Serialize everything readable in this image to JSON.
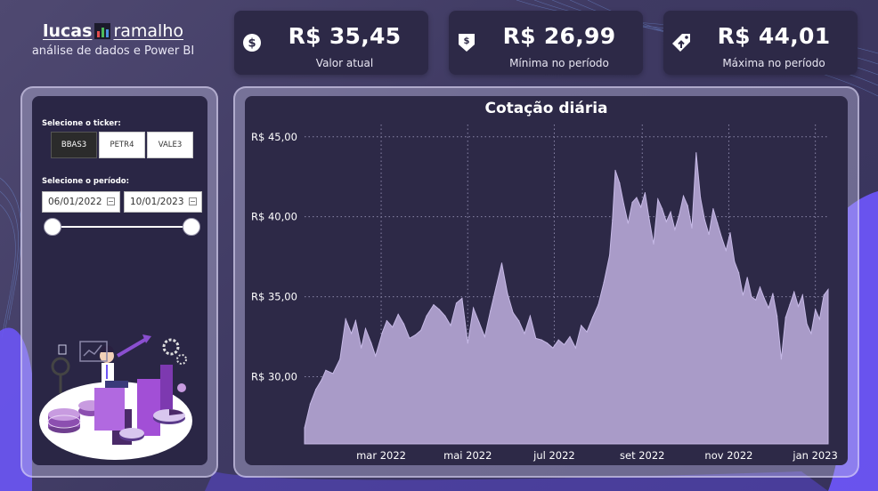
{
  "brand": {
    "name_part1": "lucas",
    "name_part2": "ramalho",
    "subtitle": "análise de dados e Power BI"
  },
  "kpis": [
    {
      "value": "R$ 35,45",
      "label": "Valor atual",
      "icon": "dollar-coin-icon"
    },
    {
      "value": "R$ 26,99",
      "label": "Mínima no período",
      "icon": "price-down-icon"
    },
    {
      "value": "R$ 44,01",
      "label": "Máxima no período",
      "icon": "price-tag-up-icon"
    }
  ],
  "filters": {
    "ticker_label": "Selecione o ticker:",
    "tickers": [
      "BBAS3",
      "PETR4",
      "VALE3"
    ],
    "selected_ticker": "BBAS3",
    "period_label": "Selecione o período:",
    "start_date": "06/01/2022",
    "end_date": "10/01/2023"
  },
  "colors": {
    "background": "#423d66",
    "card": "#2d2947",
    "area_fill": "#a99bc8",
    "accent": "#6c55f5"
  },
  "chart_data": {
    "type": "area",
    "title": "Cotação diária",
    "xlabel": "",
    "ylabel": "",
    "y_tick_labels": [
      "R$ 30,00",
      "R$ 35,00",
      "R$ 40,00",
      "R$ 45,00"
    ],
    "y_ticks": [
      30,
      35,
      40,
      45
    ],
    "ylim": [
      25.8,
      45.6
    ],
    "x_tick_labels": [
      "mar 2022",
      "mai 2022",
      "jul 2022",
      "set 2022",
      "nov 2022",
      "jan 2023"
    ],
    "x_ticks": [
      "2022-03-01",
      "2022-05-01",
      "2022-07-01",
      "2022-09-01",
      "2022-11-01",
      "2023-01-01"
    ],
    "xlim": [
      "2022-01-06",
      "2023-01-10"
    ],
    "grid": true,
    "series": [
      {
        "dates": [
          "2022-01-06",
          "2022-01-10",
          "2022-01-14",
          "2022-01-18",
          "2022-01-21",
          "2022-01-26",
          "2022-01-31",
          "2022-02-04",
          "2022-02-08",
          "2022-02-11",
          "2022-02-15",
          "2022-02-18",
          "2022-02-22",
          "2022-02-25",
          "2022-03-02",
          "2022-03-05",
          "2022-03-09",
          "2022-03-13",
          "2022-03-17",
          "2022-03-21",
          "2022-03-25",
          "2022-03-29",
          "2022-04-02",
          "2022-04-07",
          "2022-04-11",
          "2022-04-15",
          "2022-04-19",
          "2022-04-23",
          "2022-04-27",
          "2022-05-01",
          "2022-05-05",
          "2022-05-09",
          "2022-05-13",
          "2022-05-17",
          "2022-05-21",
          "2022-05-25",
          "2022-05-29",
          "2022-06-02",
          "2022-06-06",
          "2022-06-10",
          "2022-06-14",
          "2022-06-18",
          "2022-06-22",
          "2022-06-26",
          "2022-06-30",
          "2022-07-04",
          "2022-07-08",
          "2022-07-12",
          "2022-07-16",
          "2022-07-20",
          "2022-07-24",
          "2022-07-28",
          "2022-08-01",
          "2022-08-05",
          "2022-08-09",
          "2022-08-11",
          "2022-08-13",
          "2022-08-16",
          "2022-08-19",
          "2022-08-22",
          "2022-08-25",
          "2022-08-28",
          "2022-08-31",
          "2022-09-03",
          "2022-09-06",
          "2022-09-09",
          "2022-09-12",
          "2022-09-15",
          "2022-09-18",
          "2022-09-21",
          "2022-09-24",
          "2022-09-27",
          "2022-09-30",
          "2022-10-03",
          "2022-10-06",
          "2022-10-09",
          "2022-10-12",
          "2022-10-15",
          "2022-10-18",
          "2022-10-21",
          "2022-10-24",
          "2022-10-27",
          "2022-10-30",
          "2022-11-02",
          "2022-11-05",
          "2022-11-08",
          "2022-11-11",
          "2022-11-14",
          "2022-11-17",
          "2022-11-20",
          "2022-11-23",
          "2022-11-26",
          "2022-11-29",
          "2022-12-02",
          "2022-12-05",
          "2022-12-08",
          "2022-12-11",
          "2022-12-14",
          "2022-12-17",
          "2022-12-20",
          "2022-12-23",
          "2022-12-26",
          "2022-12-29",
          "2023-01-01",
          "2023-01-04",
          "2023-01-07",
          "2023-01-10"
        ],
        "values": [
          26.8,
          28.3,
          29.2,
          29.8,
          30.4,
          30.2,
          31.1,
          33.6,
          32.7,
          33.5,
          31.8,
          33.0,
          32.1,
          31.3,
          32.8,
          33.5,
          33.1,
          33.9,
          33.3,
          32.4,
          32.6,
          32.9,
          33.8,
          34.5,
          34.2,
          33.8,
          33.2,
          34.6,
          34.9,
          32.1,
          34.3,
          33.4,
          32.5,
          34.1,
          35.6,
          37.1,
          35.2,
          34.0,
          33.5,
          32.7,
          33.8,
          32.4,
          32.3,
          32.1,
          31.8,
          32.3,
          32.0,
          32.5,
          31.8,
          33.2,
          32.8,
          33.7,
          34.5,
          35.9,
          37.6,
          39.8,
          42.9,
          42.1,
          40.8,
          39.6,
          40.9,
          41.2,
          40.6,
          41.5,
          39.8,
          38.3,
          41.1,
          40.5,
          39.7,
          40.3,
          39.2,
          40.1,
          41.3,
          40.7,
          39.3,
          44.0,
          41.2,
          39.8,
          38.9,
          40.5,
          39.6,
          38.7,
          37.9,
          39.0,
          37.2,
          36.5,
          35.1,
          36.2,
          35.0,
          34.8,
          35.6,
          34.9,
          34.3,
          35.2,
          33.8,
          31.1,
          33.7,
          34.5,
          35.3,
          34.4,
          35.1,
          33.3,
          32.7,
          34.2,
          33.6,
          35.1,
          35.45
        ]
      }
    ]
  }
}
